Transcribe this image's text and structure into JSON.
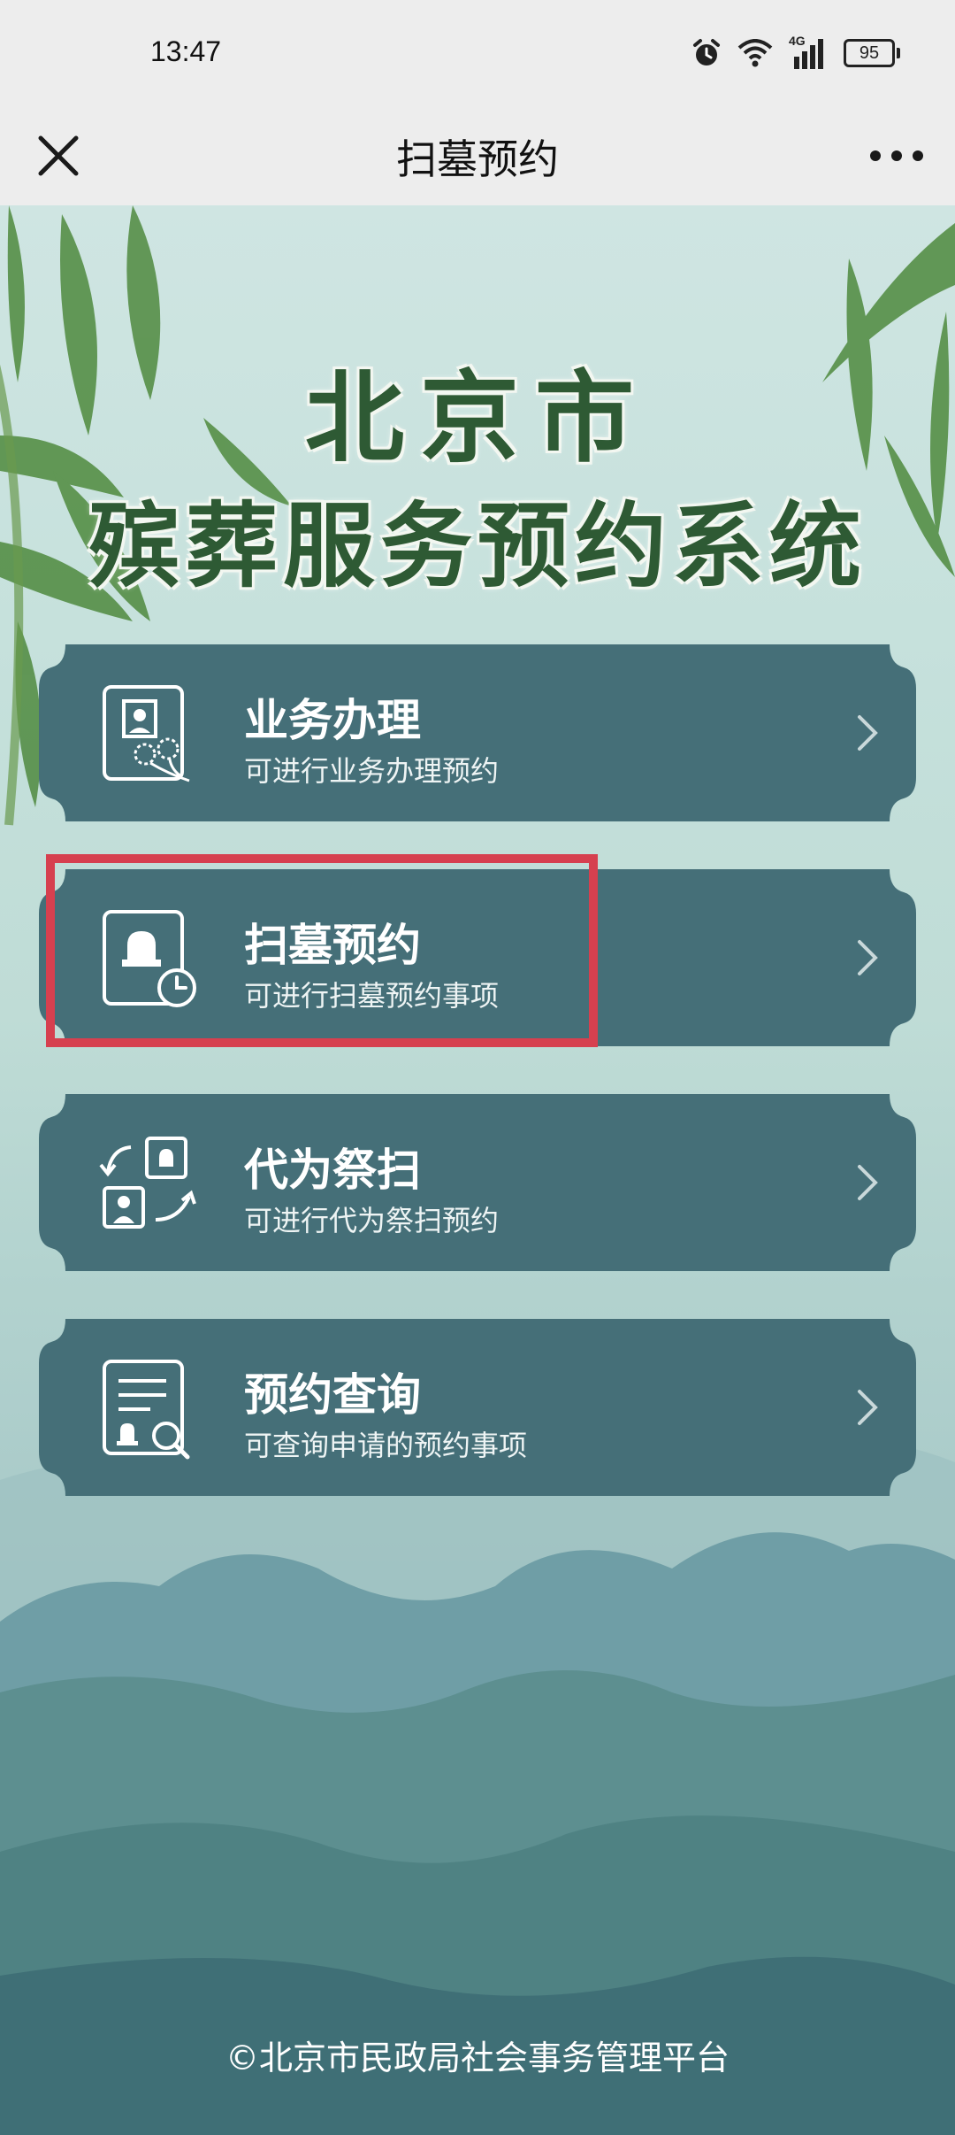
{
  "status_bar": {
    "time": "13:47",
    "network": "4G",
    "battery": "95",
    "icons": [
      "alarm-icon",
      "wifi-icon",
      "signal-icon",
      "battery-icon"
    ]
  },
  "nav": {
    "title": "扫墓预约",
    "close_icon": "close-icon",
    "more_icon": "more-icon"
  },
  "hero": {
    "line1": "北京市",
    "line2": "殡葬服务预约系统"
  },
  "menu": [
    {
      "title": "业务办理",
      "subtitle": "可进行业务办理预约",
      "icon": "document-flower-icon"
    },
    {
      "title": "扫墓预约",
      "subtitle": "可进行扫墓预约事项",
      "icon": "tombstone-clock-icon"
    },
    {
      "title": "代为祭扫",
      "subtitle": "可进行代为祭扫预约",
      "icon": "proxy-exchange-icon"
    },
    {
      "title": "预约查询",
      "subtitle": "可查询申请的预约事项",
      "icon": "document-search-icon"
    }
  ],
  "footer": "©北京市民政局社会事务管理平台",
  "colors": {
    "card": "#456f78",
    "title_text": "#2e5a34",
    "highlight": "#d6404f",
    "chrome": "#ededed"
  }
}
